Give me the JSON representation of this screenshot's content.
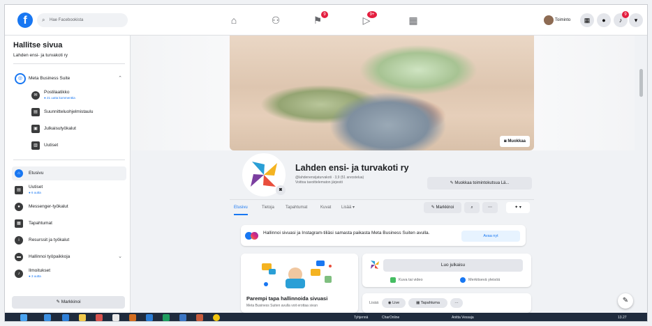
{
  "topbar": {
    "search_placeholder": "Hae Facebookista",
    "profile_label": "Toiminto",
    "nav_badges": [
      "",
      "",
      "9",
      "9+",
      ""
    ]
  },
  "sidebar": {
    "title": "Hallitse sivua",
    "subtitle": "Lahden ensi- ja turvakoti ry",
    "mbs_label": "Meta Business Suite",
    "mbs_items": [
      {
        "label": "Postilaatikko",
        "sub": "● 21 uutta kommenttia"
      },
      {
        "label": "Suunnitteluohjelmistaulu",
        "sub": ""
      },
      {
        "label": "Julkaisutyökalut",
        "sub": ""
      },
      {
        "label": "Uutiset",
        "sub": ""
      }
    ],
    "items": [
      {
        "label": "Etusivu",
        "sub": ""
      },
      {
        "label": "Uutiset",
        "sub": "● 6 uutta"
      },
      {
        "label": "Messenger-työkalut",
        "sub": ""
      },
      {
        "label": "Tapahtumat",
        "sub": ""
      },
      {
        "label": "Resurssit ja työkalut",
        "sub": ""
      },
      {
        "label": "Hallinnoi työpaikkoja",
        "sub": ""
      },
      {
        "label": "Ilmoitukset",
        "sub": "● 3 uutta"
      }
    ],
    "promote_label": "Markkinoi"
  },
  "cover": {
    "edit_label": "Muokkaa"
  },
  "page": {
    "name": "Lahden ensi- ja turvakoti ry",
    "handle": "@lahdenensijaturvakoti · 3,9 (51 arvostelua)",
    "category": "Voittoa tavoittelematon järjestö",
    "edit_label": "Muokkaa toimintokutsua Lä..."
  },
  "tabs": {
    "items": [
      "Etusivu",
      "Tietoja",
      "Tapahtumat",
      "Kuvat",
      "Lisää ▾"
    ],
    "promote_label": "Markkinoi"
  },
  "banner": {
    "text": "Hallinnoi sivuasi ja Instagram-tiliäsi samasta paikasta Meta Business Suiten avulla.",
    "try_label": "Avaa nyt"
  },
  "promo": {
    "title": "Parempi tapa hallinnoida sivuasi",
    "desc": "Meta Business Suiten avulla voit erottaa sivun"
  },
  "composer": {
    "create_label": "Luo julkaisu",
    "photo_label": "Kuva tai video",
    "tag_label": "Merkitsevä yleisöä",
    "live_label": "Live",
    "event_label": "Tapahtuma",
    "add_label": "Lisää",
    "more_label": "···"
  },
  "taskbar": {
    "item1": "Tyhjennä",
    "item2": "CharOnline",
    "item3": "Anitta Vessaja",
    "time": "13.27"
  },
  "colors": {
    "brand": "#1877f2",
    "taskbar": "#1f2b3d"
  }
}
